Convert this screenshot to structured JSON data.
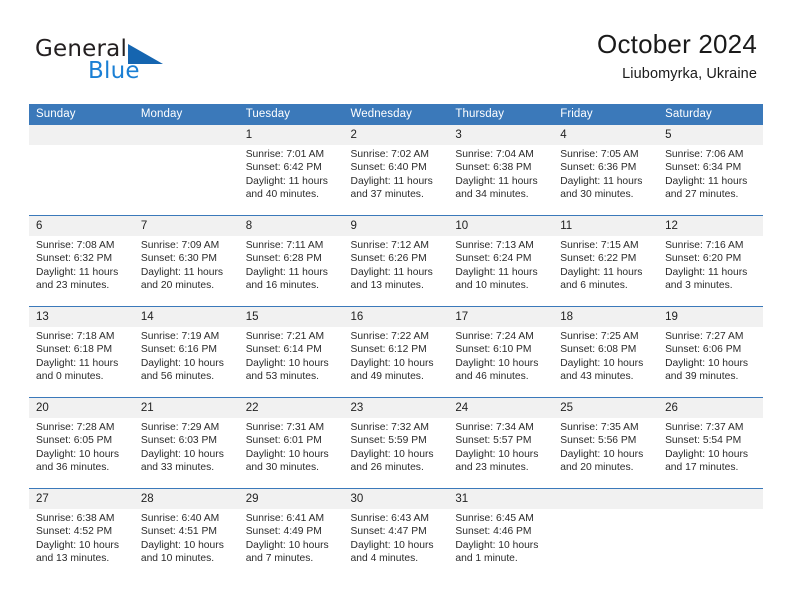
{
  "brand": {
    "name_top": "General",
    "name_bottom": "Blue",
    "accent_color": "#1a7fd4",
    "triangle_color": "#1565b0"
  },
  "header": {
    "title": "October 2024",
    "subtitle": "Liubomyrka, Ukraine"
  },
  "theme": {
    "header_blue": "#3b79ba",
    "date_band": "#f1f1f1",
    "text": "#222222"
  },
  "calendar": {
    "weekday_headers": [
      "Sunday",
      "Monday",
      "Tuesday",
      "Wednesday",
      "Thursday",
      "Friday",
      "Saturday"
    ],
    "weeks": [
      [
        {
          "day": "",
          "lines": []
        },
        {
          "day": "",
          "lines": []
        },
        {
          "day": "1",
          "lines": [
            "Sunrise: 7:01 AM",
            "Sunset: 6:42 PM",
            "Daylight: 11 hours",
            "and 40 minutes."
          ]
        },
        {
          "day": "2",
          "lines": [
            "Sunrise: 7:02 AM",
            "Sunset: 6:40 PM",
            "Daylight: 11 hours",
            "and 37 minutes."
          ]
        },
        {
          "day": "3",
          "lines": [
            "Sunrise: 7:04 AM",
            "Sunset: 6:38 PM",
            "Daylight: 11 hours",
            "and 34 minutes."
          ]
        },
        {
          "day": "4",
          "lines": [
            "Sunrise: 7:05 AM",
            "Sunset: 6:36 PM",
            "Daylight: 11 hours",
            "and 30 minutes."
          ]
        },
        {
          "day": "5",
          "lines": [
            "Sunrise: 7:06 AM",
            "Sunset: 6:34 PM",
            "Daylight: 11 hours",
            "and 27 minutes."
          ]
        }
      ],
      [
        {
          "day": "6",
          "lines": [
            "Sunrise: 7:08 AM",
            "Sunset: 6:32 PM",
            "Daylight: 11 hours",
            "and 23 minutes."
          ]
        },
        {
          "day": "7",
          "lines": [
            "Sunrise: 7:09 AM",
            "Sunset: 6:30 PM",
            "Daylight: 11 hours",
            "and 20 minutes."
          ]
        },
        {
          "day": "8",
          "lines": [
            "Sunrise: 7:11 AM",
            "Sunset: 6:28 PM",
            "Daylight: 11 hours",
            "and 16 minutes."
          ]
        },
        {
          "day": "9",
          "lines": [
            "Sunrise: 7:12 AM",
            "Sunset: 6:26 PM",
            "Daylight: 11 hours",
            "and 13 minutes."
          ]
        },
        {
          "day": "10",
          "lines": [
            "Sunrise: 7:13 AM",
            "Sunset: 6:24 PM",
            "Daylight: 11 hours",
            "and 10 minutes."
          ]
        },
        {
          "day": "11",
          "lines": [
            "Sunrise: 7:15 AM",
            "Sunset: 6:22 PM",
            "Daylight: 11 hours",
            "and 6 minutes."
          ]
        },
        {
          "day": "12",
          "lines": [
            "Sunrise: 7:16 AM",
            "Sunset: 6:20 PM",
            "Daylight: 11 hours",
            "and 3 minutes."
          ]
        }
      ],
      [
        {
          "day": "13",
          "lines": [
            "Sunrise: 7:18 AM",
            "Sunset: 6:18 PM",
            "Daylight: 11 hours",
            "and 0 minutes."
          ]
        },
        {
          "day": "14",
          "lines": [
            "Sunrise: 7:19 AM",
            "Sunset: 6:16 PM",
            "Daylight: 10 hours",
            "and 56 minutes."
          ]
        },
        {
          "day": "15",
          "lines": [
            "Sunrise: 7:21 AM",
            "Sunset: 6:14 PM",
            "Daylight: 10 hours",
            "and 53 minutes."
          ]
        },
        {
          "day": "16",
          "lines": [
            "Sunrise: 7:22 AM",
            "Sunset: 6:12 PM",
            "Daylight: 10 hours",
            "and 49 minutes."
          ]
        },
        {
          "day": "17",
          "lines": [
            "Sunrise: 7:24 AM",
            "Sunset: 6:10 PM",
            "Daylight: 10 hours",
            "and 46 minutes."
          ]
        },
        {
          "day": "18",
          "lines": [
            "Sunrise: 7:25 AM",
            "Sunset: 6:08 PM",
            "Daylight: 10 hours",
            "and 43 minutes."
          ]
        },
        {
          "day": "19",
          "lines": [
            "Sunrise: 7:27 AM",
            "Sunset: 6:06 PM",
            "Daylight: 10 hours",
            "and 39 minutes."
          ]
        }
      ],
      [
        {
          "day": "20",
          "lines": [
            "Sunrise: 7:28 AM",
            "Sunset: 6:05 PM",
            "Daylight: 10 hours",
            "and 36 minutes."
          ]
        },
        {
          "day": "21",
          "lines": [
            "Sunrise: 7:29 AM",
            "Sunset: 6:03 PM",
            "Daylight: 10 hours",
            "and 33 minutes."
          ]
        },
        {
          "day": "22",
          "lines": [
            "Sunrise: 7:31 AM",
            "Sunset: 6:01 PM",
            "Daylight: 10 hours",
            "and 30 minutes."
          ]
        },
        {
          "day": "23",
          "lines": [
            "Sunrise: 7:32 AM",
            "Sunset: 5:59 PM",
            "Daylight: 10 hours",
            "and 26 minutes."
          ]
        },
        {
          "day": "24",
          "lines": [
            "Sunrise: 7:34 AM",
            "Sunset: 5:57 PM",
            "Daylight: 10 hours",
            "and 23 minutes."
          ]
        },
        {
          "day": "25",
          "lines": [
            "Sunrise: 7:35 AM",
            "Sunset: 5:56 PM",
            "Daylight: 10 hours",
            "and 20 minutes."
          ]
        },
        {
          "day": "26",
          "lines": [
            "Sunrise: 7:37 AM",
            "Sunset: 5:54 PM",
            "Daylight: 10 hours",
            "and 17 minutes."
          ]
        }
      ],
      [
        {
          "day": "27",
          "lines": [
            "Sunrise: 6:38 AM",
            "Sunset: 4:52 PM",
            "Daylight: 10 hours",
            "and 13 minutes."
          ]
        },
        {
          "day": "28",
          "lines": [
            "Sunrise: 6:40 AM",
            "Sunset: 4:51 PM",
            "Daylight: 10 hours",
            "and 10 minutes."
          ]
        },
        {
          "day": "29",
          "lines": [
            "Sunrise: 6:41 AM",
            "Sunset: 4:49 PM",
            "Daylight: 10 hours",
            "and 7 minutes."
          ]
        },
        {
          "day": "30",
          "lines": [
            "Sunrise: 6:43 AM",
            "Sunset: 4:47 PM",
            "Daylight: 10 hours",
            "and 4 minutes."
          ]
        },
        {
          "day": "31",
          "lines": [
            "Sunrise: 6:45 AM",
            "Sunset: 4:46 PM",
            "Daylight: 10 hours",
            "and 1 minute."
          ]
        },
        {
          "day": "",
          "lines": []
        },
        {
          "day": "",
          "lines": []
        }
      ]
    ]
  }
}
